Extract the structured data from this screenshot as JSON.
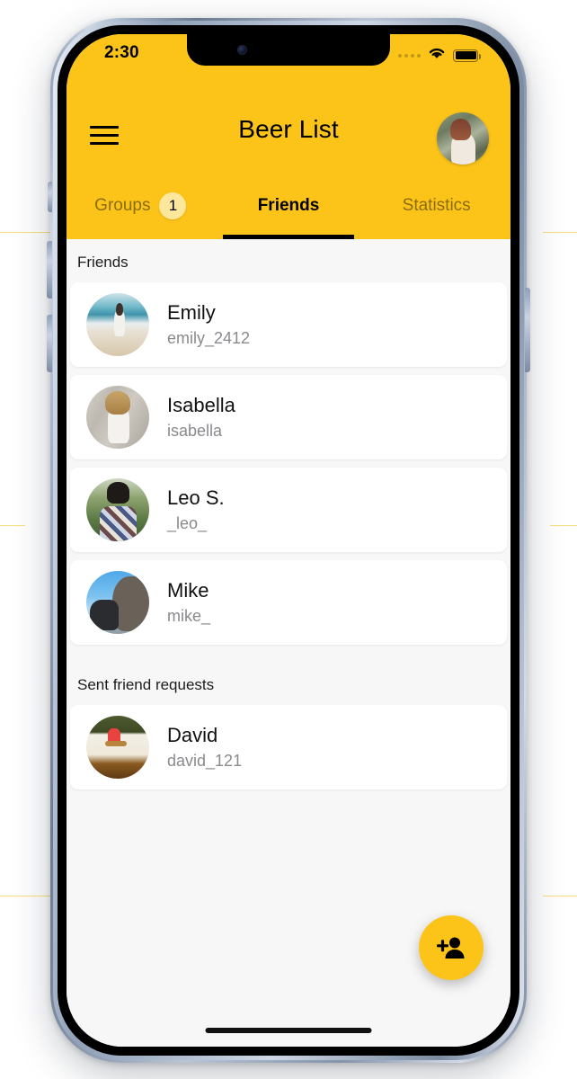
{
  "status_bar": {
    "time": "2:30",
    "cellular_icon": "cellular-dots-icon",
    "wifi_icon": "wifi-icon",
    "battery_icon": "battery-full-icon"
  },
  "header": {
    "menu_icon": "hamburger-menu-icon",
    "title": "Beer List",
    "avatar_icon": "profile-avatar-image",
    "background_color": "#FCC419"
  },
  "tabs": [
    {
      "label": "Groups",
      "active": false,
      "badge": "1"
    },
    {
      "label": "Friends",
      "active": true,
      "badge": ""
    },
    {
      "label": "Statistics",
      "active": false,
      "badge": ""
    }
  ],
  "sections": [
    {
      "title": "Friends",
      "rows": [
        {
          "name": "Emily",
          "handle": "emily_2412",
          "avatar": "emily-avatar-image"
        },
        {
          "name": "Isabella",
          "handle": "isabella",
          "avatar": "isabella-avatar-image"
        },
        {
          "name": "Leo S.",
          "handle": "_leo_",
          "avatar": "leo-avatar-image"
        },
        {
          "name": "Mike",
          "handle": "mike_",
          "avatar": "mike-avatar-image"
        }
      ]
    },
    {
      "title": "Sent friend requests",
      "rows": [
        {
          "name": "David",
          "handle": "david_121",
          "avatar": "david-avatar-image"
        }
      ]
    }
  ],
  "fab": {
    "icon": "add-person-icon",
    "background_color": "#FCC419"
  },
  "colors": {
    "accent": "#FCC419",
    "badge": "#FDE79C",
    "list_background": "#f7f7f7",
    "card_background": "#ffffff",
    "handle_text": "#8a8a8e"
  }
}
